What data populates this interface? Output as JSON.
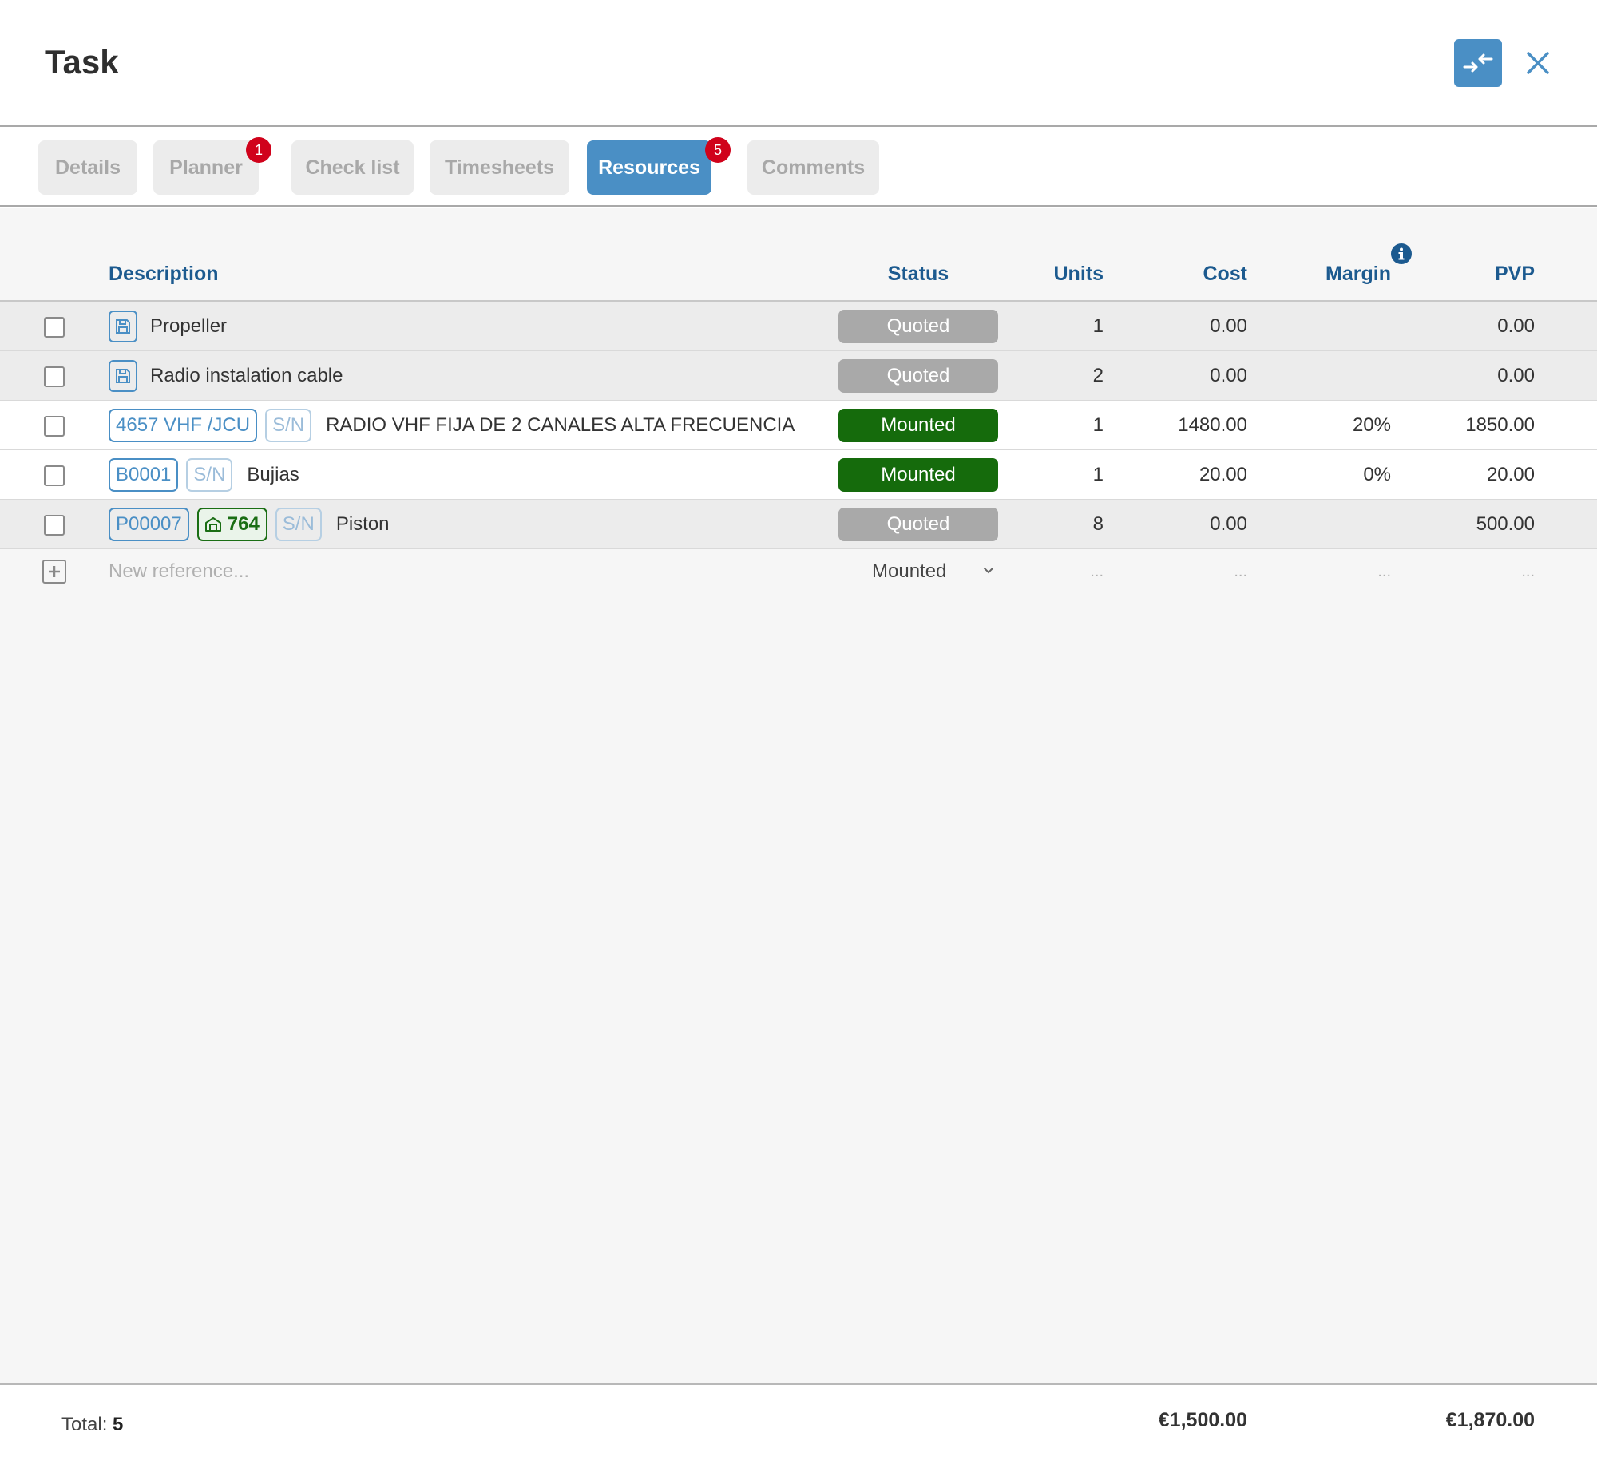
{
  "header": {
    "title": "Task"
  },
  "tabs": [
    {
      "label": "Details",
      "badge": null
    },
    {
      "label": "Planner",
      "badge": "1"
    },
    {
      "label": "Check list",
      "badge": null
    },
    {
      "label": "Timesheets",
      "badge": null
    },
    {
      "label": "Resources",
      "badge": "5"
    },
    {
      "label": "Comments",
      "badge": null
    }
  ],
  "table": {
    "columns": {
      "description": "Description",
      "status": "Status",
      "units": "Units",
      "cost": "Cost",
      "margin": "Margin",
      "pvp": "PVP"
    },
    "rows": [
      {
        "ref": null,
        "warehouse": null,
        "sn": null,
        "description": "Propeller",
        "status": "Quoted",
        "units": "1",
        "cost": "0.00",
        "margin": "",
        "pvp": "0.00"
      },
      {
        "ref": null,
        "warehouse": null,
        "sn": null,
        "description": "Radio instalation cable",
        "status": "Quoted",
        "units": "2",
        "cost": "0.00",
        "margin": "",
        "pvp": "0.00"
      },
      {
        "ref": "4657 VHF /JCU",
        "warehouse": null,
        "sn": "S/N",
        "description": "RADIO VHF FIJA DE 2 CANALES ALTA FRECUENCIA",
        "status": "Mounted",
        "units": "1",
        "cost": "1480.00",
        "margin": "20%",
        "pvp": "1850.00"
      },
      {
        "ref": "B0001",
        "warehouse": null,
        "sn": "S/N",
        "description": "Bujias",
        "status": "Mounted",
        "units": "1",
        "cost": "20.00",
        "margin": "0%",
        "pvp": "20.00"
      },
      {
        "ref": "P00007",
        "warehouse": "764",
        "sn": "S/N",
        "description": "Piston",
        "status": "Quoted",
        "units": "8",
        "cost": "0.00",
        "margin": "",
        "pvp": "500.00"
      }
    ],
    "new_row": {
      "placeholder": "New reference...",
      "status": "Mounted",
      "units": "...",
      "cost": "...",
      "margin": "...",
      "pvp": "..."
    }
  },
  "footer": {
    "total_label": "Total:",
    "total_count": "5",
    "cost_total": "€1,500.00",
    "pvp_total": "€1,870.00"
  },
  "colors": {
    "accent": "#4a8fc5",
    "header_text": "#1c5a8f",
    "mounted": "#156b0c",
    "quoted": "#a9a9a9",
    "badge": "#d0021b"
  },
  "icons": {
    "collapse": "collapse-arrows-icon",
    "close": "close-icon",
    "info": "info-icon",
    "save": "save-icon",
    "warehouse": "warehouse-icon",
    "add": "plus-icon",
    "chevron": "chevron-down-icon"
  }
}
